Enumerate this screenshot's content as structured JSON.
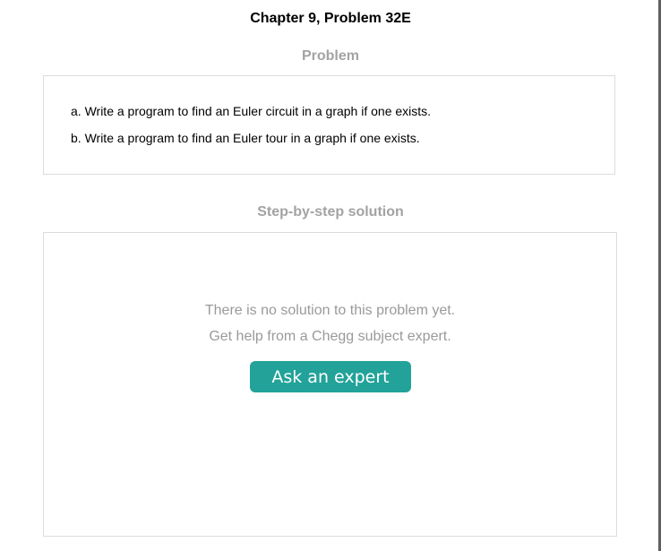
{
  "header": {
    "title": "Chapter 9, Problem 32E"
  },
  "problem": {
    "heading": "Problem",
    "lines": [
      "a. Write a program to find an Euler circuit in a graph if one exists.",
      "b. Write a program to find an Euler tour in a graph if one exists."
    ]
  },
  "solution": {
    "heading": "Step-by-step solution",
    "message_line1": "There is no solution to this problem yet.",
    "message_line2": "Get help from a Chegg subject expert.",
    "ask_button_label": "Ask an expert"
  },
  "colors": {
    "accent_button": "#22a299",
    "muted_text": "#a3a3a3",
    "border": "#dcdcdc"
  }
}
